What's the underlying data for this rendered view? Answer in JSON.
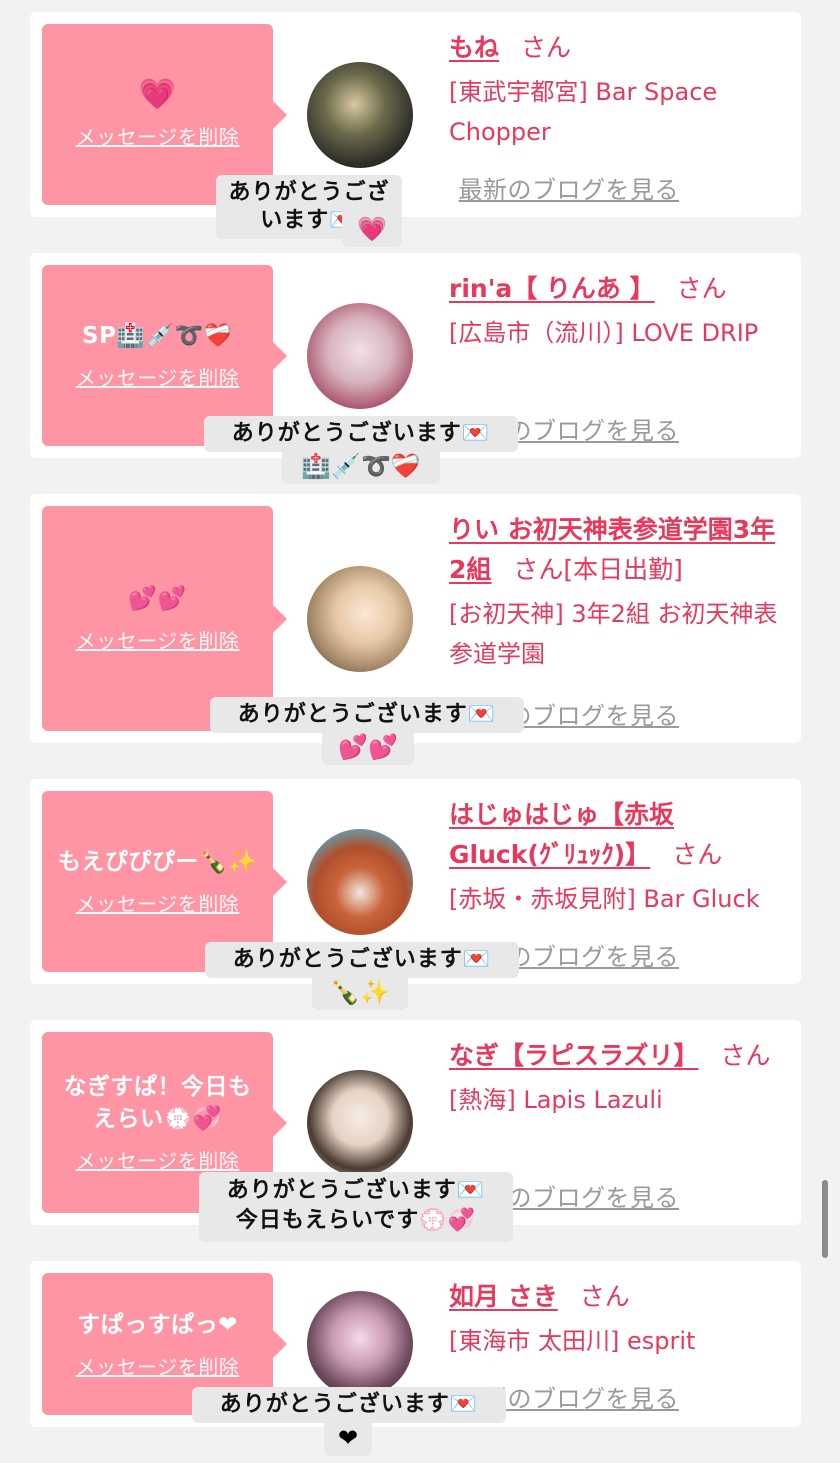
{
  "ui": {
    "delete_label": "メッセージを削除",
    "blog_label": "最新のブログを見る",
    "san": "さん",
    "thanks": "ありがとうございます💌"
  },
  "items": [
    {
      "message": "💗",
      "name": "もね",
      "extra": "",
      "shop": "[東武宇都宮] Bar Space Chopper",
      "reply_sub": "💗"
    },
    {
      "message": "SP🏥💉➰❤️‍🩹",
      "name": "rin'a【 りんあ 】",
      "extra": "",
      "shop": "[広島市（流川）] LOVE DRIP",
      "reply_sub": "🏥💉➰❤️‍🩹"
    },
    {
      "message": "💕💕",
      "name": "りい お初天神表参道学園3年2組",
      "extra": "[本日出勤]",
      "shop": "[お初天神] 3年2組 お初天神表参道学園",
      "reply_sub": "💕💕"
    },
    {
      "message": "もえぴぴぴー🍾✨",
      "name": "はじゅはじゅ【赤坂Gluck(ｸﾞﾘｭｯｸ)】",
      "extra": "",
      "shop": "[赤坂・赤坂見附] Bar Gluck",
      "reply_sub": "🍾✨"
    },
    {
      "message": "なぎすぱ！今日もえらい💮💞",
      "name": "なぎ【ラピスラズリ】",
      "extra": "",
      "shop": "[熱海] Lapis Lazuli",
      "reply_sub": "今日もえらいです💮💞"
    },
    {
      "message": "すぱっすぱっ❤",
      "name": "如月 さき",
      "extra": "",
      "shop": "[東海市 太田川] esprit",
      "reply_sub": "❤"
    }
  ],
  "colors": {
    "accent": "#e8385c",
    "message_bg": "#ff94a5",
    "bubble_bg": "#e8e8e8",
    "page_bg": "#f2f2f3"
  }
}
